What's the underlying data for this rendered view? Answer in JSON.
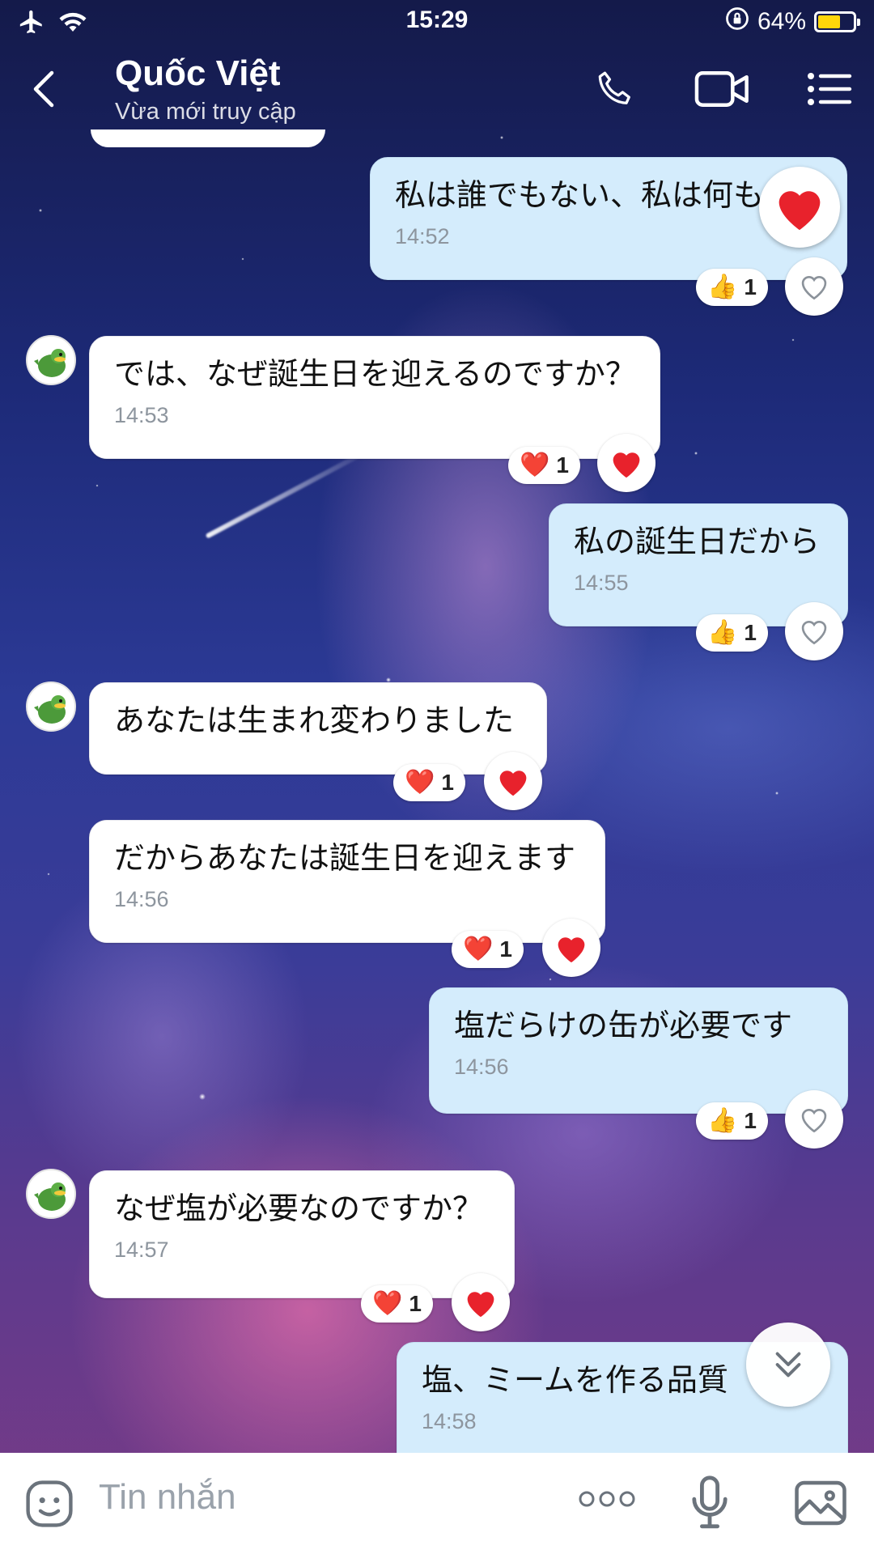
{
  "status_bar": {
    "time": "15:29",
    "battery_percent": "64%",
    "battery_level": 0.64
  },
  "header": {
    "contact_name": "Quốc Việt",
    "contact_status": "Vừa mới truy cập"
  },
  "messages": [
    {
      "direction": "sent",
      "text": "私は誰でもない、私は何も",
      "time": "14:52",
      "reaction_emoji": "👍",
      "reaction_count": "1"
    },
    {
      "direction": "received",
      "text": "では、なぜ誕生日を迎えるのですか？",
      "time": "14:53",
      "reaction_emoji": "❤️",
      "reaction_count": "1"
    },
    {
      "direction": "sent",
      "text": "私の誕生日だから",
      "time": "14:55",
      "reaction_emoji": "👍",
      "reaction_count": "1"
    },
    {
      "direction": "received",
      "text": "あなたは生まれ変わりました",
      "time": "",
      "reaction_emoji": "❤️",
      "reaction_count": "1"
    },
    {
      "direction": "received",
      "text": "だからあなたは誕生日を迎えます",
      "time": "14:56",
      "reaction_emoji": "❤️",
      "reaction_count": "1"
    },
    {
      "direction": "sent",
      "text": "塩だらけの缶が必要です",
      "time": "14:56",
      "reaction_emoji": "👍",
      "reaction_count": "1"
    },
    {
      "direction": "received",
      "text": "なぜ塩が必要なのですか？",
      "time": "14:57",
      "reaction_emoji": "❤️",
      "reaction_count": "1"
    },
    {
      "direction": "sent",
      "text": "塩、ミームを作る品質",
      "time": "14:58"
    }
  ],
  "input_bar": {
    "placeholder": "Tin nhắn"
  },
  "colors": {
    "sent_bubble": "#d4ecfc",
    "received_bubble": "#ffffff",
    "heart": "#e8222c"
  },
  "icons": [
    "airplane-icon",
    "wifi-icon",
    "orientation-lock-icon",
    "battery-icon",
    "back-icon",
    "phone-icon",
    "video-call-icon",
    "menu-list-icon",
    "heart-icon",
    "thumbs-up-icon",
    "chevron-double-down-icon",
    "sticker-icon",
    "more-icon",
    "microphone-icon",
    "image-icon"
  ]
}
